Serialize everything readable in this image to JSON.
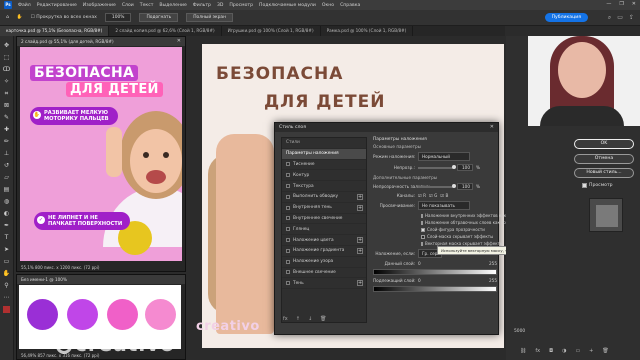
{
  "menubar": {
    "logo": "Ps",
    "items": [
      "Файл",
      "Редактирование",
      "Изображение",
      "Слои",
      "Текст",
      "Выделение",
      "Фильтр",
      "3D",
      "Просмотр",
      "Подключаемые модули",
      "Окно",
      "Справка"
    ],
    "win_controls": [
      "—",
      "❐",
      "✕"
    ]
  },
  "optionsbar": {
    "checkbox_label": "Прокрутка во всех окнах",
    "zoom_value": "100%",
    "fit_label": "Подогнать",
    "fullscreen_label": "Полный экран",
    "publish_label": "Публикация"
  },
  "tabs": [
    "карточка.psd @ 75,1% (Безопасна, RGB/8#)",
    "2 слайд копия.psd @ 62,6% (Слой 1, RGB/8#)",
    "Игрушки.psd @ 100% (Слой 1, RGB/8#)",
    "Рамка.psd @ 100% (Слой 1, RGB/8#)"
  ],
  "docwin": {
    "title": "2 слайд.psd @ 55,1% (для детей, RGB/8#)",
    "banner_line1": "БЕЗОПАСНА",
    "banner_line2": "ДЛЯ ДЕТЕЙ",
    "pill1": "РАЗВИВАЕТ МЕЛКУЮ МОТОРИКУ ПАЛЬЦЕВ",
    "pill2": "НЕ ЛИПНЕТ И НЕ ПАЧКАЕТ ПОВЕРХНОСТИ",
    "status": "55,1%    800 пикс. x 1200 пикс. (72 ppi)"
  },
  "swatchwin": {
    "title": "Без имени-1 @ 100%",
    "status": "56,49%    857 пикс. x 316 пикс. (72 ppi)",
    "colors": [
      "#9a2fd6",
      "#c046e8",
      "#f060c8",
      "#f58ad0"
    ]
  },
  "maincanvas": {
    "line1": "БЕЗОПАСНА",
    "line2": "ДЛЯ ДЕТЕЙ"
  },
  "dialog": {
    "title": "Стиль слоя",
    "close": "✕",
    "styles_header": "Стили",
    "styles": [
      {
        "label": "Параметры наложения",
        "checkbox": false,
        "plus": false,
        "selected": true
      },
      {
        "label": "Тиснение",
        "checkbox": true,
        "plus": false
      },
      {
        "label": "Контур",
        "checkbox": true,
        "plus": false
      },
      {
        "label": "Текстура",
        "checkbox": true,
        "plus": false
      },
      {
        "label": "Выполнить обводку",
        "checkbox": true,
        "plus": true
      },
      {
        "label": "Внутренняя тень",
        "checkbox": true,
        "plus": true
      },
      {
        "label": "Внутреннее свечение",
        "checkbox": true,
        "plus": false
      },
      {
        "label": "Глянец",
        "checkbox": true,
        "plus": false
      },
      {
        "label": "Наложение цвета",
        "checkbox": true,
        "plus": true
      },
      {
        "label": "Наложение градиента",
        "checkbox": true,
        "plus": true
      },
      {
        "label": "Наложение узора",
        "checkbox": true,
        "plus": false
      },
      {
        "label": "Внешнее свечение",
        "checkbox": true,
        "plus": false
      },
      {
        "label": "Тень",
        "checkbox": true,
        "plus": true
      }
    ],
    "footer_icons": [
      "fx",
      "↑",
      "↓",
      "🗑"
    ],
    "props_title": "Параметры наложения",
    "general_label": "Основные параметры",
    "blend_mode_label": "Режим наложения:",
    "blend_mode_value": "Нормальный",
    "opacity_label": "Непрозр.:",
    "opacity_value": "100",
    "advanced_label": "Дополнительные параметры",
    "fill_label": "Непрозрачность заливки:",
    "fill_value": "100",
    "channels_label": "Каналы:",
    "channels": [
      "R",
      "G",
      "B"
    ],
    "knockout_label": "Просвечивание:",
    "knockout_value": "Не показывать",
    "checks": [
      {
        "label": "Наложение внутренних эффектов как группы",
        "on": false
      },
      {
        "label": "Наложение обтравочных слоев как группы",
        "on": true
      },
      {
        "label": "Слой-фигура прозрачности",
        "on": true
      },
      {
        "label": "Слой-маска скрывает эффекты",
        "on": false
      },
      {
        "label": "Векторная маска скрывает эффекты",
        "on": false
      }
    ],
    "blendif_label": "Наложение, если:",
    "blendif_value": "Гр. серо",
    "this_layer_label": "Данный слой:",
    "this_layer_values": [
      "0",
      "255"
    ],
    "underlying_label": "Подлежащий слой:",
    "underlying_values": [
      "0",
      "255"
    ],
    "percent": "%"
  },
  "tooltip": "Используйте векторную маску, чтобы скрыть слой и эффекты, в не для создания слой-маски",
  "rightpanel": {
    "ok_label": "OK",
    "cancel_label": "Отмена",
    "newstyle_label": "Новый стиль...",
    "preview_label": "Просмотр",
    "zoom": "5000"
  },
  "watermarks": {
    "brand": "creativo",
    "canvas": "creativo"
  }
}
